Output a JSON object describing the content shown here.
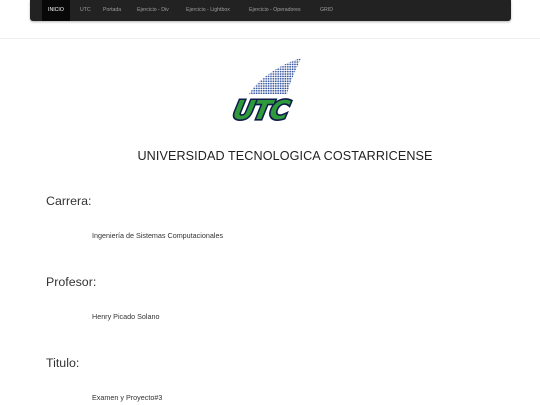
{
  "nav": {
    "items": [
      {
        "label": "INICIO",
        "active": true
      },
      {
        "label": "UTC"
      },
      {
        "label": "Portada"
      },
      {
        "label": "Ejercicio - Div"
      },
      {
        "label": "Ejercicio - Lightbox"
      },
      {
        "label": "Ejercicio - Operadores"
      },
      {
        "label": "GRID"
      }
    ]
  },
  "logo": {
    "text": "UTC",
    "colors": {
      "blue": "#1c3f94",
      "green": "#2e9a3a",
      "outline": "#0d1b4a"
    }
  },
  "header": {
    "title": "UNIVERSIDAD TECNOLOGICA COSTARRICENSE"
  },
  "sections": [
    {
      "label": "Carrera:",
      "value": "Ingeniería de Sistemas Computacionales"
    },
    {
      "label": "Profesor:",
      "value": "Henry Picado Solano"
    },
    {
      "label": "Titulo:",
      "value": "Examen y Proyecto#3"
    }
  ]
}
